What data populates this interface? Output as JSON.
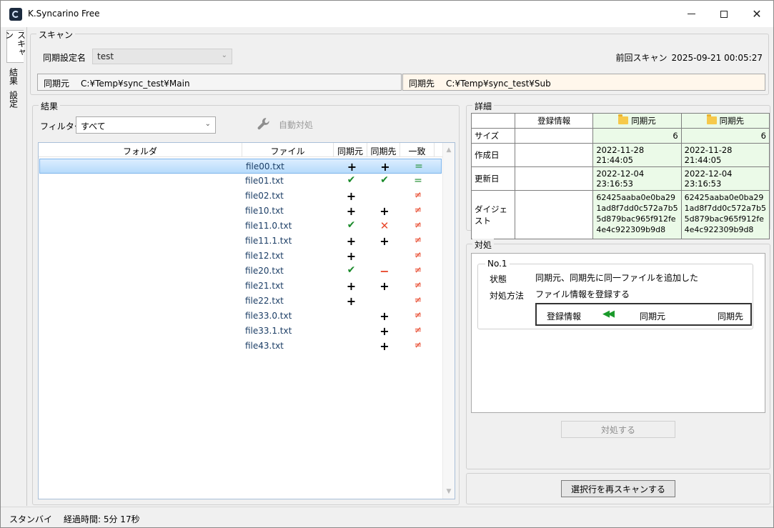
{
  "window": {
    "title": "K.Syncarino Free"
  },
  "tabs": {
    "scan": "スキャン",
    "results": "結果",
    "settings": "設定"
  },
  "scan": {
    "group_label": "スキャン",
    "setting_name_label": "同期設定名",
    "setting_name_value": "test",
    "last_scan_label": "前回スキャン",
    "last_scan_value": "2025-09-21 00:05:27",
    "source_label": "同期元",
    "source_path": "C:¥Temp¥sync_test¥Main",
    "dest_label": "同期先",
    "dest_path": "C:¥Temp¥sync_test¥Sub"
  },
  "results": {
    "group_label": "結果",
    "filter_label": "フィルター",
    "filter_value": "すべて",
    "auto_button": "自動対処",
    "columns": {
      "folder": "フォルダ",
      "file": "ファイル",
      "src": "同期元",
      "dst": "同期先",
      "match": "一致"
    },
    "rows": [
      {
        "folder": "",
        "file": "file00.txt",
        "src": "+",
        "dst": "+",
        "match": "="
      },
      {
        "folder": "",
        "file": "file01.txt",
        "src": "✔",
        "dst": "✔",
        "match": "="
      },
      {
        "folder": "",
        "file": "file02.txt",
        "src": "+",
        "dst": "",
        "match": "≠"
      },
      {
        "folder": "",
        "file": "file10.txt",
        "src": "+",
        "dst": "+",
        "match": "≠"
      },
      {
        "folder": "",
        "file": "file11.0.txt",
        "src": "✔",
        "dst": "✕",
        "match": "≠"
      },
      {
        "folder": "",
        "file": "file11.1.txt",
        "src": "+",
        "dst": "+",
        "match": "≠"
      },
      {
        "folder": "",
        "file": "file12.txt",
        "src": "+",
        "dst": "",
        "match": "≠"
      },
      {
        "folder": "",
        "file": "file20.txt",
        "src": "✔",
        "dst": "−",
        "match": "≠"
      },
      {
        "folder": "",
        "file": "file21.txt",
        "src": "+",
        "dst": "+",
        "match": "≠"
      },
      {
        "folder": "",
        "file": "file22.txt",
        "src": "+",
        "dst": "",
        "match": "≠"
      },
      {
        "folder": "",
        "file": "file33.0.txt",
        "src": "",
        "dst": "+",
        "match": "≠"
      },
      {
        "folder": "",
        "file": "file33.1.txt",
        "src": "",
        "dst": "+",
        "match": "≠"
      },
      {
        "folder": "",
        "file": "file43.txt",
        "src": "",
        "dst": "+",
        "match": "≠"
      }
    ]
  },
  "detail": {
    "group_label": "詳細",
    "headers": {
      "registered": "登録情報",
      "src": "同期元",
      "dst": "同期先"
    },
    "size_label": "サイズ",
    "size_reg": "",
    "size_src": "6",
    "size_dst": "6",
    "created_label": "作成日",
    "created_reg": "",
    "created_src": "2022-11-28 21:44:05",
    "created_dst": "2022-11-28 21:44:05",
    "updated_label": "更新日",
    "updated_reg": "",
    "updated_src": "2022-12-04 23:16:53",
    "updated_dst": "2022-12-04 23:16:53",
    "digest_label": "ダイジェスト",
    "digest_reg": "",
    "digest_src_lines": [
      "62425aaba0e0ba29",
      "1ad8f7dd0c572a7b5",
      "5d879bac965f912fe",
      "4e4c922309b9d8"
    ],
    "digest_dst_lines": [
      "62425aaba0e0ba29",
      "1ad8f7dd0c572a7b5",
      "5d879bac965f912fe",
      "4e4c922309b9d8"
    ]
  },
  "action": {
    "group_label": "対処",
    "item_label": "No.1",
    "state_label": "状態",
    "state_value": "同期元、同期先に同一ファイルを追加した",
    "method_label": "対処方法",
    "method_value": "ファイル情報を登録する",
    "dir_registered": "登録情報",
    "dir_arrow": "◀◀",
    "dir_src": "同期元",
    "dir_dst": "同期先",
    "action_button": "対処する",
    "rescan_button": "選択行を再スキャンする"
  },
  "status": {
    "state": "スタンバイ",
    "elapsed": "経過時間: 5分 17秒"
  }
}
